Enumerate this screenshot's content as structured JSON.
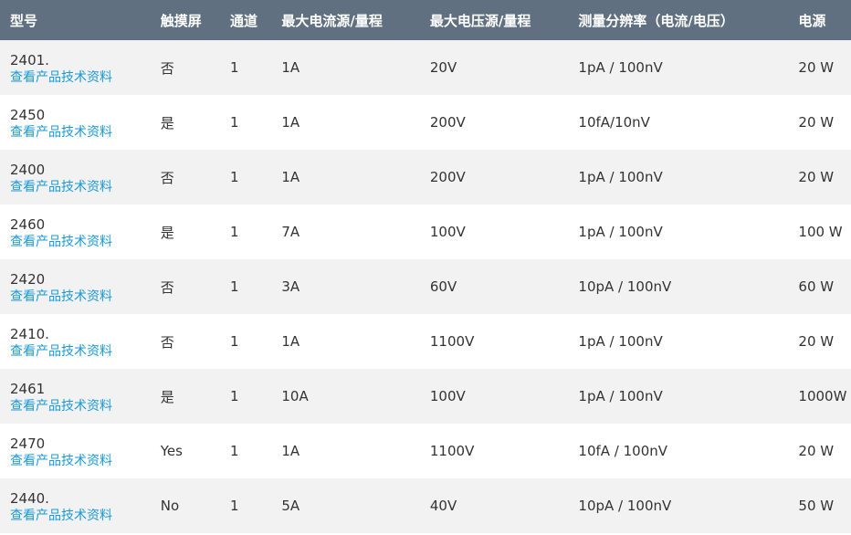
{
  "headers": [
    "型号",
    "触摸屏",
    "通道",
    "最大电流源/量程",
    "最大电压源/量程",
    "测量分辨率（电流/电压）",
    "电源"
  ],
  "link_label": "查看产品技术资料",
  "rows": [
    {
      "model": "2401.",
      "touch": "否",
      "channels": "1",
      "max_current": "1A",
      "max_voltage": "20V",
      "resolution": "1pA / 100nV",
      "power": "20 W"
    },
    {
      "model": "2450",
      "touch": "是",
      "channels": "1",
      "max_current": "1A",
      "max_voltage": "200V",
      "resolution": "10fA/10nV",
      "power": "20 W"
    },
    {
      "model": "2400",
      "touch": "否",
      "channels": "1",
      "max_current": "1A",
      "max_voltage": "200V",
      "resolution": "1pA / 100nV",
      "power": "20 W"
    },
    {
      "model": "2460",
      "touch": "是",
      "channels": "1",
      "max_current": "7A",
      "max_voltage": "100V",
      "resolution": "1pA / 100nV",
      "power": "100 W"
    },
    {
      "model": "2420",
      "touch": "否",
      "channels": "1",
      "max_current": "3A",
      "max_voltage": "60V",
      "resolution": "10pA / 100nV",
      "power": "60 W"
    },
    {
      "model": "2410.",
      "touch": "否",
      "channels": "1",
      "max_current": "1A",
      "max_voltage": "1100V",
      "resolution": "1pA / 100nV",
      "power": "20 W"
    },
    {
      "model": "2461",
      "touch": "是",
      "channels": "1",
      "max_current": "10A",
      "max_voltage": "100V",
      "resolution": "1pA / 100nV",
      "power": "1000W"
    },
    {
      "model": "2470",
      "touch": "Yes",
      "channels": "1",
      "max_current": "1A",
      "max_voltage": "1100V",
      "resolution": "10fA / 100nV",
      "power": "20 W"
    },
    {
      "model": "2440.",
      "touch": "No",
      "channels": "1",
      "max_current": "5A",
      "max_voltage": "40V",
      "resolution": "10pA / 100nV",
      "power": "50 W"
    }
  ]
}
